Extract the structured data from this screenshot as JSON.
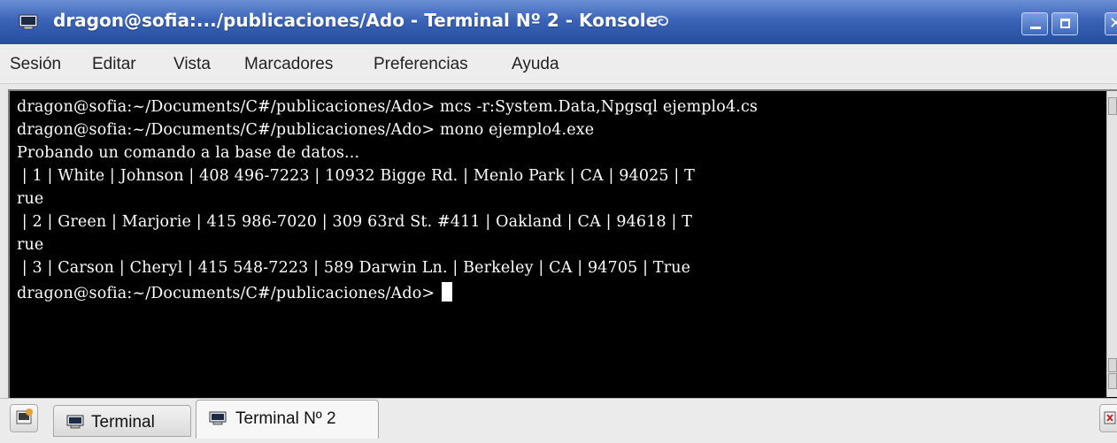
{
  "window": {
    "title": "dragon@sofia:.../publicaciones/Ado - Terminal Nº 2 - Konsole",
    "controls": {
      "minimize": "minimize",
      "maximize": "maximize",
      "close": "✕"
    }
  },
  "menu": {
    "items": [
      "Sesión",
      "Editar",
      "Vista",
      "Marcadores",
      "Preferencias",
      "Ayuda"
    ]
  },
  "terminal": {
    "lines": [
      "dragon@sofia:~/Documents/C#/publicaciones/Ado> mcs -r:System.Data,Npgsql ejemplo4.cs",
      "dragon@sofia:~/Documents/C#/publicaciones/Ado> mono ejemplo4.exe",
      "Probando un comando a la base de datos...",
      " | 1 | White | Johnson | 408 496-7223 | 10932 Bigge Rd. | Menlo Park | CA | 94025 | T",
      "rue",
      " | 2 | Green | Marjorie | 415 986-7020 | 309 63rd St. #411 | Oakland | CA | 94618 | T",
      "rue",
      " | 3 | Carson | Cheryl | 415 548-7223 | 589 Darwin Ln. | Berkeley | CA | 94705 | True",
      "dragon@sofia:~/Documents/C#/publicaciones/Ado>"
    ],
    "colors": {
      "background": "#000000",
      "foreground": "#ffffff"
    }
  },
  "tabs": [
    {
      "label": "Terminal",
      "active": false
    },
    {
      "label": "Terminal Nº 2",
      "active": true
    }
  ],
  "icons": {
    "app": "konsole-icon",
    "activity": "swirl-icon",
    "new_tab": "new-tab-icon",
    "close_tab": "close-tab-icon"
  },
  "colors": {
    "titlebar": "#3b64b8",
    "accent": "#244d9e"
  }
}
